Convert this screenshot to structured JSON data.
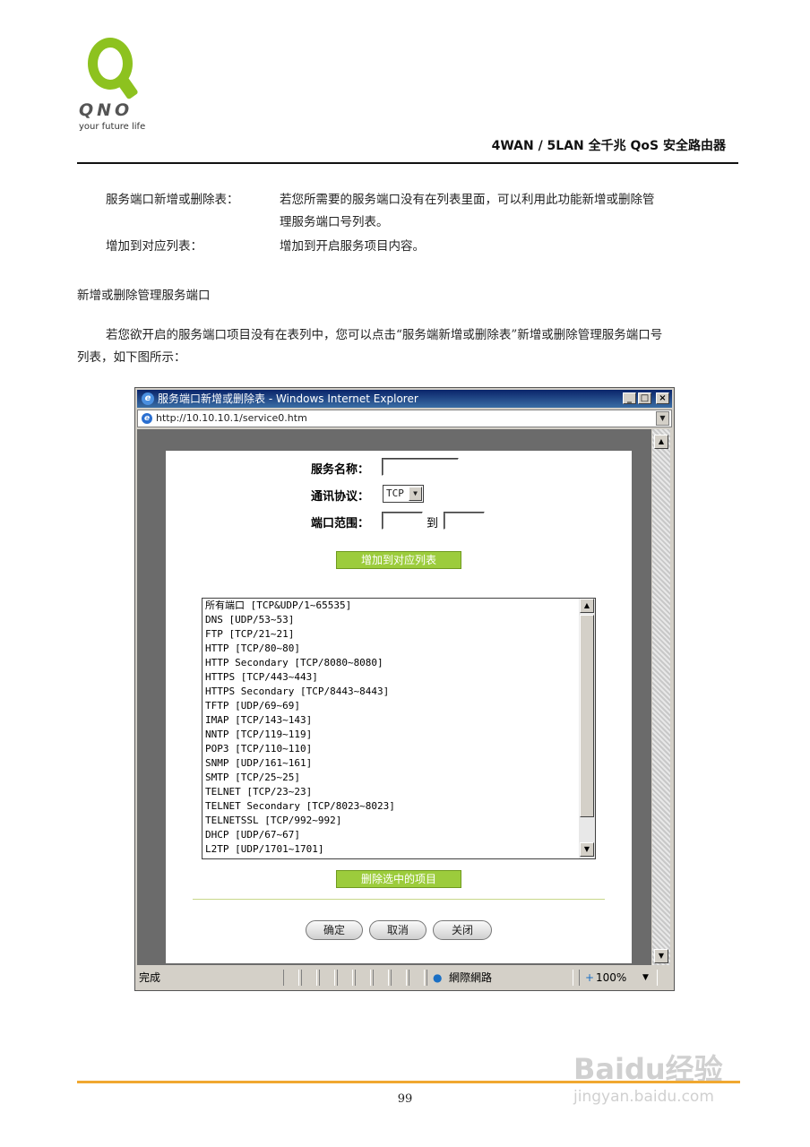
{
  "header": {
    "brand": "QNO",
    "tagline": "your future life",
    "title": "4WAN / 5LAN 全千兆 QoS 安全路由器"
  },
  "definitions": [
    {
      "term": "服务端口新增或删除表：",
      "desc_line1": "若您所需要的服务端口没有在列表里面，可以利用此功能新增或删除管",
      "desc_line2": "理服务端口号列表。"
    },
    {
      "term": "增加到对应列表：",
      "desc_line1": "增加到开启服务项目内容。"
    }
  ],
  "section_heading": "新增或删除管理服务端口",
  "paragraph": {
    "line1": "若您欲开启的服务端口项目没有在表列中，您可以点击“服务端新增或删除表”新增或删除管理服务端口号",
    "line2": "列表，如下图所示："
  },
  "window": {
    "title": "服务端口新增或删除表 - Windows Internet Explorer",
    "address": "http://10.10.10.1/service0.htm",
    "form": {
      "service_name_label": "服务名称：",
      "protocol_label": "通讯协议：",
      "protocol_value": "TCP",
      "port_range_label": "端口范围：",
      "to_label": "到",
      "add_button": "增加到对应列表",
      "delete_button": "删除选中的项目",
      "ok_button": "确定",
      "cancel_button": "取消",
      "close_button": "关闭"
    },
    "services": [
      "所有端口 [TCP&UDP/1~65535]",
      "DNS [UDP/53~53]",
      "FTP [TCP/21~21]",
      "HTTP [TCP/80~80]",
      "HTTP Secondary [TCP/8080~8080]",
      "HTTPS [TCP/443~443]",
      "HTTPS Secondary [TCP/8443~8443]",
      "TFTP [UDP/69~69]",
      "IMAP [TCP/143~143]",
      "NNTP [TCP/119~119]",
      "POP3 [TCP/110~110]",
      "SNMP [UDP/161~161]",
      "SMTP [TCP/25~25]",
      "TELNET [TCP/23~23]",
      "TELNET Secondary [TCP/8023~8023]",
      "TELNETSSL [TCP/992~992]",
      "DHCP [UDP/67~67]",
      "L2TP [UDP/1701~1701]"
    ],
    "status": {
      "left": "完成",
      "zone": "網際網路",
      "zoom": "100%"
    }
  },
  "footer": {
    "page_number": "99",
    "watermark_logo": "Baidu经验",
    "watermark_url": "jingyan.baidu.com"
  }
}
